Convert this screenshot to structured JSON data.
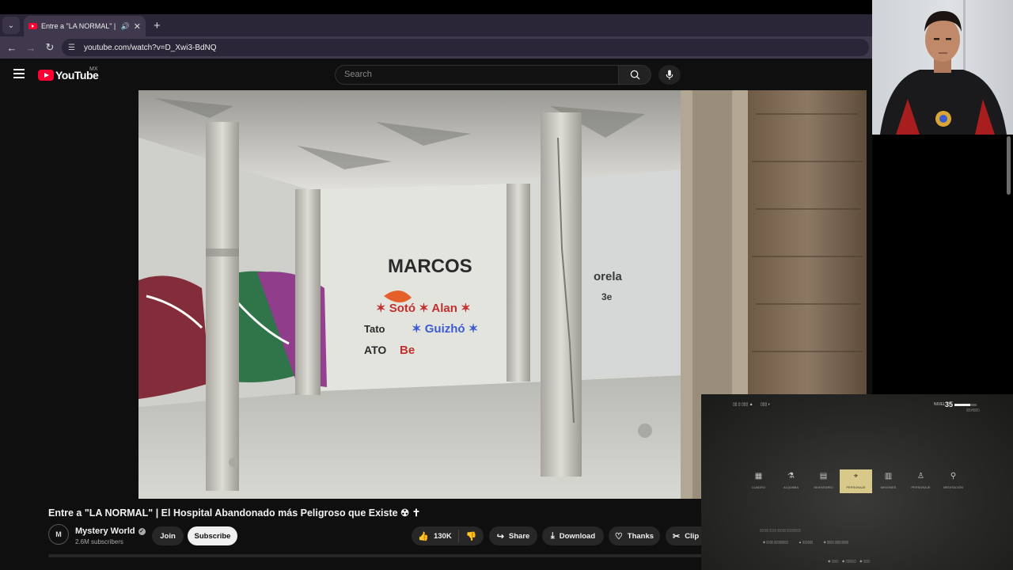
{
  "browser": {
    "tab_title": "Entre a \"LA NORMAL\" | El Hospital Abandonado más Peligroso que Existe",
    "url": "youtube.com/watch?v=D_Xwi3-BdNQ"
  },
  "youtube": {
    "logo_text": "YouTube",
    "country_code": "MX",
    "search_placeholder": "Search"
  },
  "video": {
    "title": "Entre a \"LA NORMAL\" | El Hospital Abandonado más Peligroso que Existe ☢ ✝",
    "channel": "Mystery World",
    "subscribers": "2.6M subscribers",
    "join_label": "Join",
    "subscribe_label": "Subscribe",
    "likes": "130K",
    "share_label": "Share",
    "download_label": "Download",
    "thanks_label": "Thanks",
    "clip_label": "Clip"
  },
  "game": {
    "level_label": "NIVEL",
    "level": "35",
    "xp_level_fraction": 0.7,
    "menu": [
      {
        "icon": "map-icon",
        "label": "CUADRO",
        "selected": false
      },
      {
        "icon": "cauldron-icon",
        "label": "ALQUIMIA",
        "selected": false
      },
      {
        "icon": "inventory-icon",
        "label": "INVENTARIO",
        "selected": false
      },
      {
        "icon": "crosshair-icon",
        "label": "PERSONAJE",
        "selected": true
      },
      {
        "icon": "book-icon",
        "label": "MISIONES",
        "selected": false
      },
      {
        "icon": "character-icon",
        "label": "PERSONAJE",
        "selected": false
      },
      {
        "icon": "meditation-icon",
        "label": "MEDITACIÓN",
        "selected": false
      }
    ]
  }
}
